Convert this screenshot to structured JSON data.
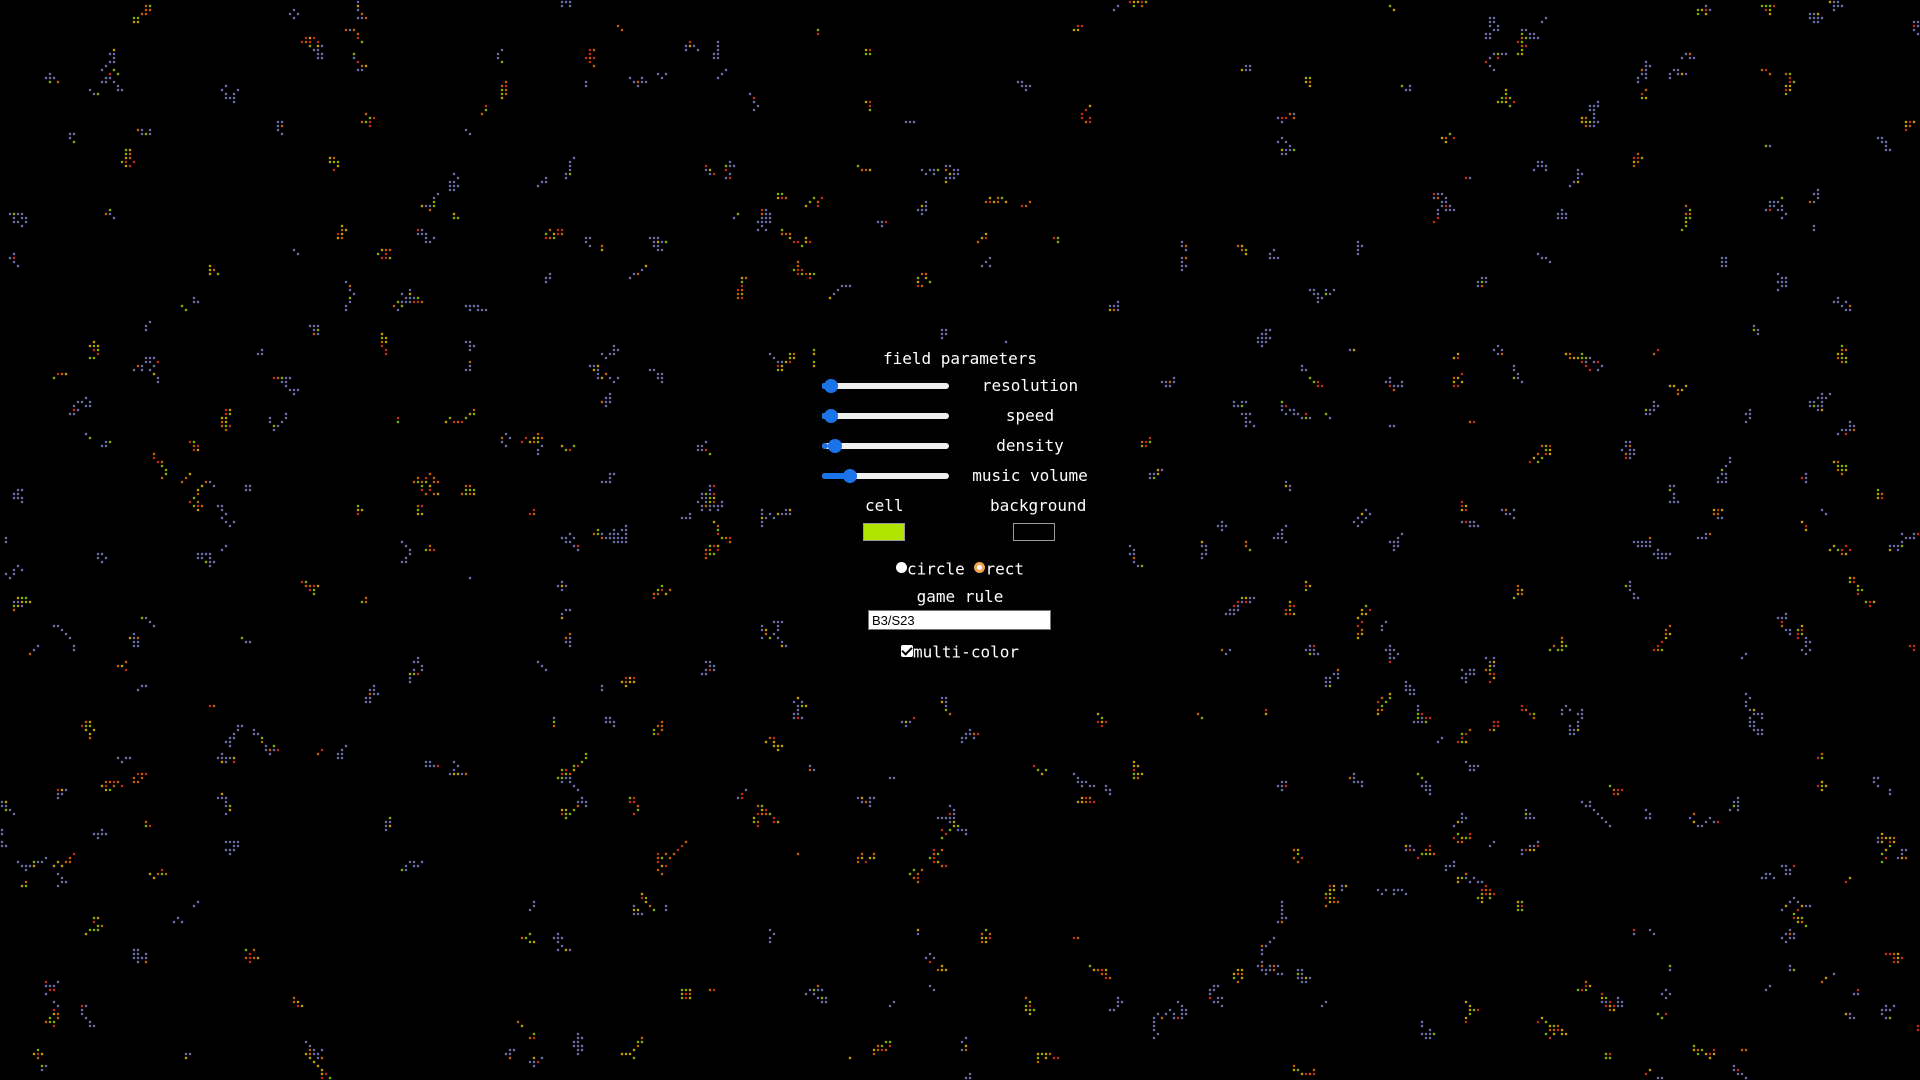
{
  "panel": {
    "title": "field parameters",
    "sliders": [
      {
        "label": "resolution",
        "value": 0.02
      },
      {
        "label": "speed",
        "value": 0.02
      },
      {
        "label": "density",
        "value": 0.05
      },
      {
        "label": "music volume",
        "value": 0.19
      }
    ],
    "colors": {
      "cell_label": "cell",
      "background_label": "background",
      "cell_color": "#aee400",
      "background_color": "#000000"
    },
    "shape": {
      "circle_label": "circle",
      "rect_label": "rect",
      "selected": "rect"
    },
    "rule": {
      "label": "game rule",
      "value": "B3/S23"
    },
    "multicolor": {
      "label": "multi-color",
      "checked": true
    }
  },
  "field": {
    "cell_palette": [
      "#8a8ad6",
      "#ff3b1f",
      "#ffd200",
      "#aee400",
      "#ff7a00"
    ],
    "slider_accent": "#1a73e8"
  }
}
